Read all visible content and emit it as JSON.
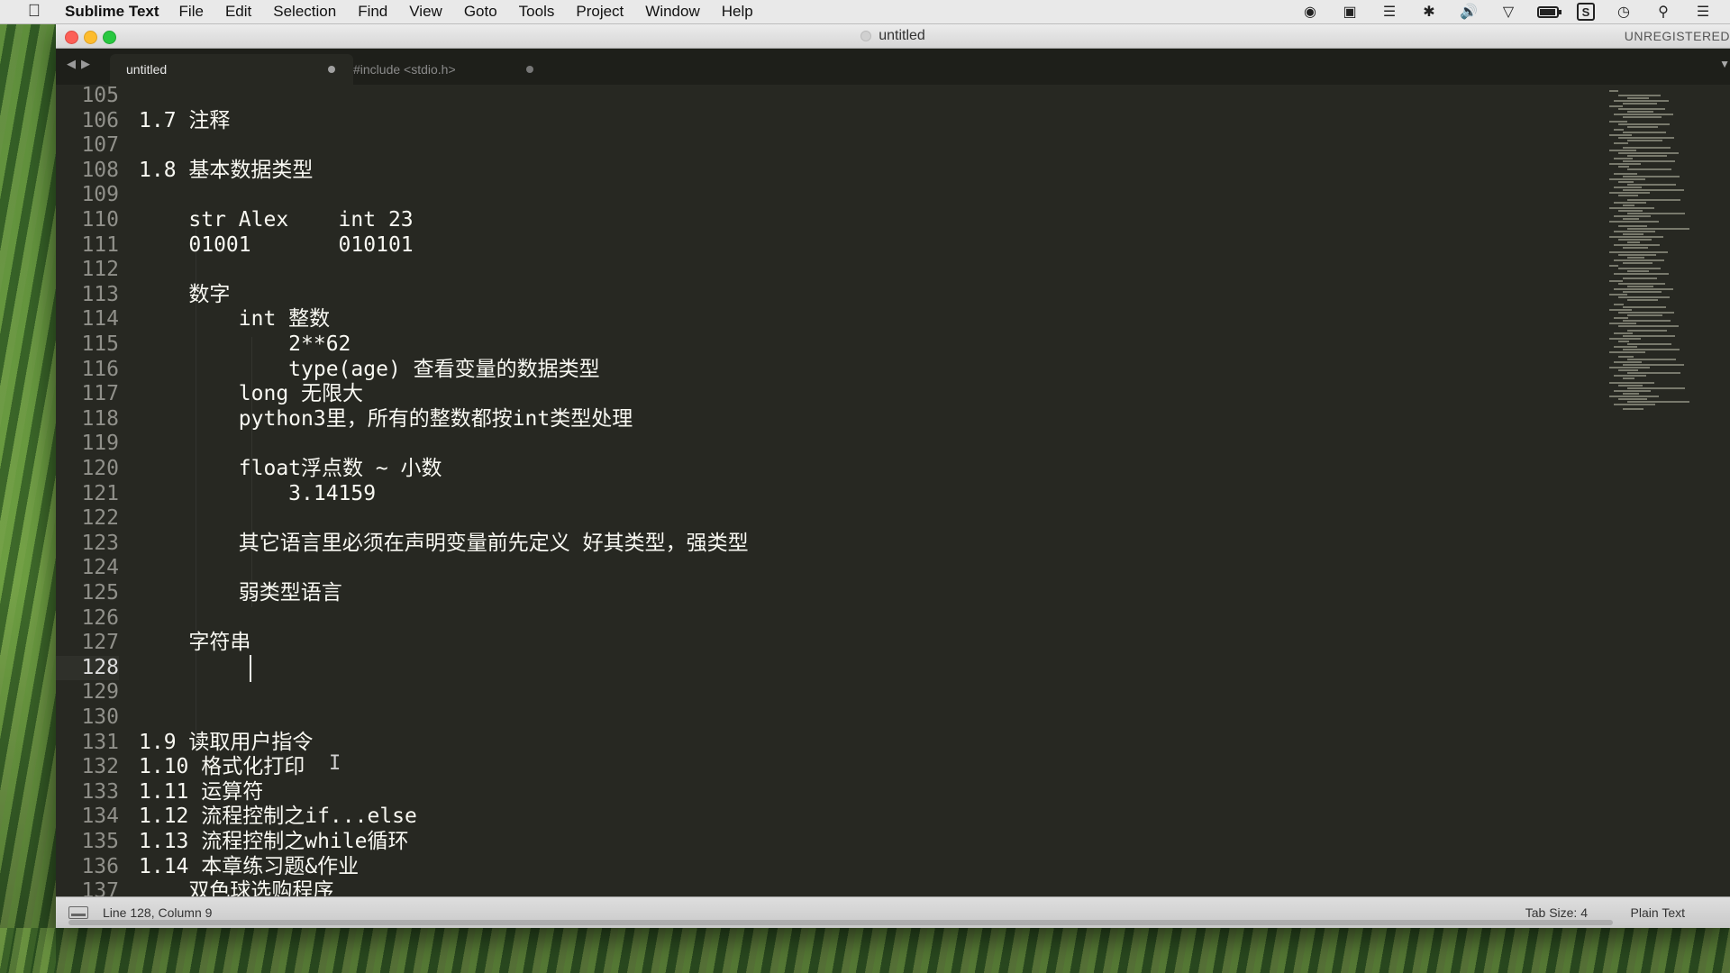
{
  "menubar": {
    "app_name": "Sublime Text",
    "items": [
      "File",
      "Edit",
      "Selection",
      "Find",
      "View",
      "Goto",
      "Tools",
      "Project",
      "Window",
      "Help"
    ],
    "status_icons": [
      "evernote-icon",
      "screen-record-icon",
      "stacks-icon",
      "bluetooth-icon",
      "volume-icon",
      "wifi-icon",
      "battery-icon",
      "scrivener-icon",
      "clock-icon",
      "spotlight-search-icon",
      "notification-center-icon"
    ]
  },
  "window": {
    "title": "untitled",
    "registration": "UNREGISTERED"
  },
  "tabs": [
    {
      "label": "untitled",
      "active": true,
      "dirty": true
    },
    {
      "label": "#include <stdio.h>",
      "active": false,
      "dirty": true
    }
  ],
  "editor": {
    "current_line": 128,
    "lines": [
      {
        "n": "105",
        "text": ""
      },
      {
        "n": "106",
        "text": "1.7 注释"
      },
      {
        "n": "107",
        "text": ""
      },
      {
        "n": "108",
        "text": "1.8 基本数据类型"
      },
      {
        "n": "109",
        "text": ""
      },
      {
        "n": "110",
        "text": "    str Alex    int 23"
      },
      {
        "n": "111",
        "text": "    01001       010101"
      },
      {
        "n": "112",
        "text": ""
      },
      {
        "n": "113",
        "text": "    数字"
      },
      {
        "n": "114",
        "text": "        int 整数"
      },
      {
        "n": "115",
        "text": "            2**62"
      },
      {
        "n": "116",
        "text": "            type(age) 查看变量的数据类型"
      },
      {
        "n": "117",
        "text": "        long 无限大"
      },
      {
        "n": "118",
        "text": "        python3里，所有的整数都按int类型处理"
      },
      {
        "n": "119",
        "text": ""
      },
      {
        "n": "120",
        "text": "        float浮点数 ~ 小数"
      },
      {
        "n": "121",
        "text": "            3.14159"
      },
      {
        "n": "122",
        "text": ""
      },
      {
        "n": "123",
        "text": "        其它语言里必须在声明变量前先定义 好其类型，强类型"
      },
      {
        "n": "124",
        "text": ""
      },
      {
        "n": "125",
        "text": "        弱类型语言"
      },
      {
        "n": "126",
        "text": ""
      },
      {
        "n": "127",
        "text": "    字符串"
      },
      {
        "n": "128",
        "text": ""
      },
      {
        "n": "129",
        "text": ""
      },
      {
        "n": "130",
        "text": ""
      },
      {
        "n": "131",
        "text": "1.9 读取用户指令"
      },
      {
        "n": "132",
        "text": "1.10 格式化打印"
      },
      {
        "n": "133",
        "text": "1.11 运算符"
      },
      {
        "n": "134",
        "text": "1.12 流程控制之if...else"
      },
      {
        "n": "135",
        "text": "1.13 流程控制之while循环"
      },
      {
        "n": "136",
        "text": "1.14 本章练习题&作业"
      },
      {
        "n": "137",
        "text": "    双色球选购程序"
      }
    ]
  },
  "statusbar": {
    "position": "Line 128, Column 9",
    "tab_size": "Tab Size: 4",
    "syntax": "Plain Text"
  }
}
